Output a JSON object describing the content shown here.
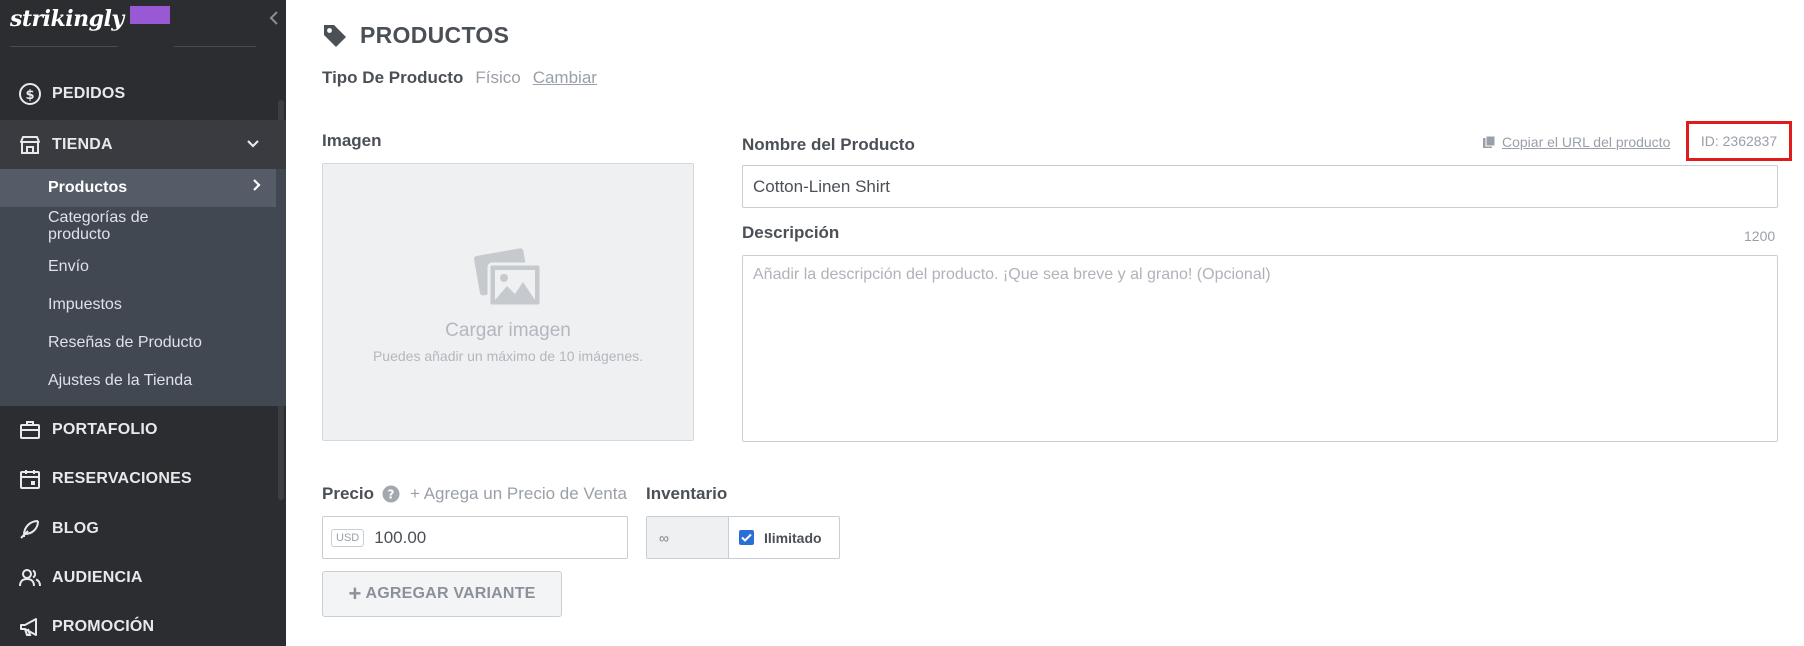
{
  "brand": {
    "logo_text": "strikingly"
  },
  "sidebar": {
    "items": [
      {
        "label": "PEDIDOS",
        "icon": "dollar-circle-icon"
      },
      {
        "label": "TIENDA",
        "icon": "store-icon"
      },
      {
        "label": "PORTAFOLIO",
        "icon": "briefcase-icon"
      },
      {
        "label": "RESERVACIONES",
        "icon": "calendar-icon"
      },
      {
        "label": "BLOG",
        "icon": "feather-icon"
      },
      {
        "label": "AUDIENCIA",
        "icon": "users-icon"
      },
      {
        "label": "PROMOCIÓN",
        "icon": "megaphone-icon"
      }
    ],
    "store_subitems": [
      {
        "label": "Productos"
      },
      {
        "label": "Categorías de producto"
      },
      {
        "label": "Envío"
      },
      {
        "label": "Impuestos"
      },
      {
        "label": "Reseñas de Producto"
      },
      {
        "label": "Ajustes de la Tienda"
      }
    ]
  },
  "header": {
    "title": "PRODUCTOS",
    "product_type_label": "Tipo De Producto",
    "product_type_value": "Físico",
    "change_link": "Cambiar"
  },
  "form": {
    "image": {
      "label": "Imagen",
      "upload_title": "Cargar imagen",
      "upload_hint": "Puedes añadir un máximo de 10 imágenes."
    },
    "name": {
      "label": "Nombre del Producto",
      "value": "Cotton-Linen Shirt",
      "copy_url_label": "Copiar el URL del producto",
      "id_text": "ID: 2362837"
    },
    "description": {
      "label": "Descripción",
      "char_limit": "1200",
      "placeholder": "Añadir la descripción del producto. ¡Que sea breve y al grano! (Opcional)"
    },
    "price": {
      "label": "Precio",
      "add_sale_label": "+ Agrega un Precio de Venta",
      "currency": "USD",
      "value": "100.00"
    },
    "inventory": {
      "label": "Inventario",
      "quantity": "∞",
      "unlimited_label": "Ilimitado",
      "unlimited_checked": true
    },
    "add_variant_label": "AGREGAR VARIANTE"
  },
  "colors": {
    "sidebar_bg": "#2c2d30",
    "subnav_bg": "#424852",
    "accent_purple": "#9a59d4",
    "highlight_red": "#e01b1b",
    "checkbox_blue": "#2a6fd6"
  }
}
